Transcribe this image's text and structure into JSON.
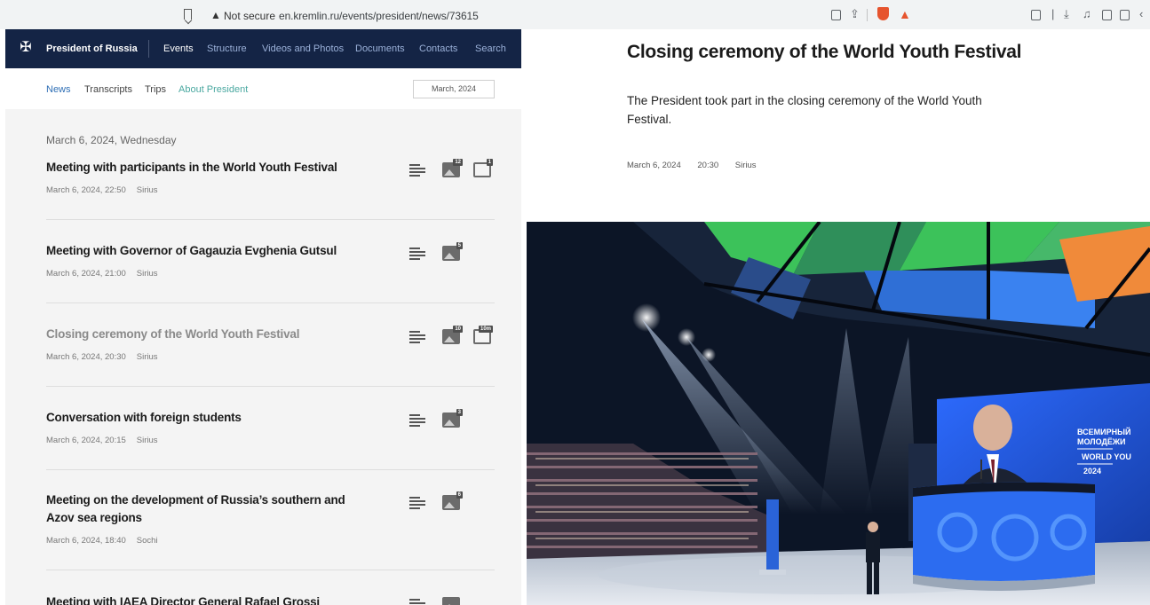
{
  "browser": {
    "security_label": "Not secure",
    "url": "en.kremlin.ru/events/president/news/73615",
    "warning_glyph": "▲"
  },
  "site": {
    "brand": "President of Russia",
    "nav": [
      "Events",
      "Structure",
      "Videos and Photos",
      "Documents",
      "Contacts",
      "Search"
    ],
    "subnav": [
      "News",
      "Transcripts",
      "Trips",
      "About President"
    ],
    "date_filter": "March, 2024"
  },
  "list": {
    "day_heading": "March 6, 2024, Wednesday",
    "items": [
      {
        "title": "Meeting with participants in the World Youth Festival",
        "date": "March 6, 2024, 22:50",
        "place": "Sirius",
        "photos": "12",
        "video": "1"
      },
      {
        "title": "Meeting with Governor of Gagauzia Evghenia Gutsul",
        "date": "March 6, 2024, 21:00",
        "place": "Sirius",
        "photos": "5"
      },
      {
        "title": "Closing ceremony of the World Youth Festival",
        "date": "March 6, 2024, 20:30",
        "place": "Sirius",
        "photos": "10",
        "video": "10m"
      },
      {
        "title": "Conversation with foreign students",
        "date": "March 6, 2024, 20:15",
        "place": "Sirius",
        "photos": "3"
      },
      {
        "title": "Meeting on the development of Russia’s southern and Azov sea regions",
        "date": "March 6, 2024, 18:40",
        "place": "Sochi",
        "photos": "6"
      },
      {
        "title": "Meeting with IAEA Director General Rafael Grossi"
      }
    ]
  },
  "article": {
    "title": "Closing ceremony of the World Youth Festival",
    "lead": "The President took part in the closing ceremony of the World Youth Festival.",
    "date": "March 6, 2024",
    "time": "20:30",
    "place": "Sirius",
    "screen_text": [
      "ВСЕМИРНЫЙ",
      "МОЛОДЁЖИ",
      "WORLD YOU",
      "2024"
    ]
  },
  "colors": {
    "nav_bg": "#142445",
    "link_blue": "#2f6fb5",
    "link_teal": "#4aa8a0",
    "list_bg": "#f4f4f4"
  }
}
